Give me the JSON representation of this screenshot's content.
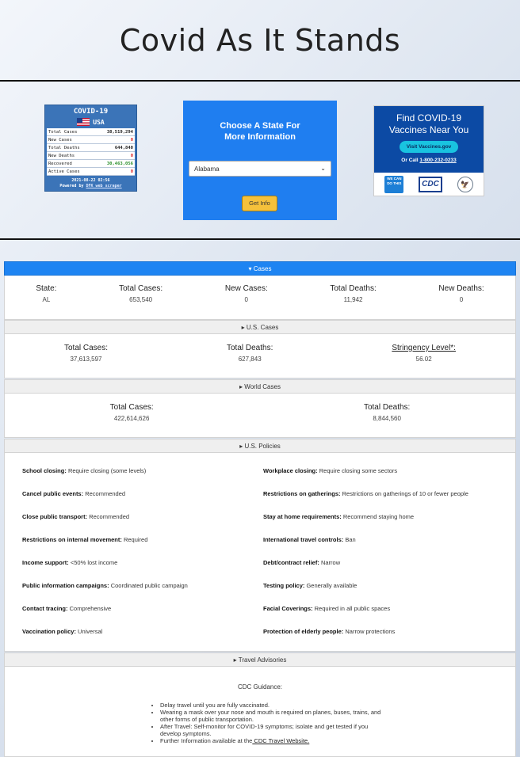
{
  "header": {
    "title": "Covid As It Stands"
  },
  "widget": {
    "title": "COVID-19",
    "country": "USA",
    "rows": [
      {
        "label": "Total Cases",
        "value": "38,519,294"
      },
      {
        "label": "New Cases",
        "value": "0"
      },
      {
        "label": "Total Deaths",
        "value": "644,840"
      },
      {
        "label": "New Deaths",
        "value": "0"
      },
      {
        "label": "Recovered",
        "value": "30,463,056"
      },
      {
        "label": "Active Cases",
        "value": "0"
      }
    ],
    "timestamp": "2021-08-22 02:56",
    "powered_prefix": "Powered by",
    "powered_link": "DFK web scraper"
  },
  "chooser": {
    "title_line1": "Choose A State For",
    "title_line2": "More Information",
    "selected_state": "Alabama",
    "button_label": "Get Info"
  },
  "vaccine": {
    "title_line1": "Find COVID-19",
    "title_line2": "Vaccines Near You",
    "button_label": "Visit Vaccines.gov",
    "call_prefix": "Or Call",
    "phone": "1-800-232-0233",
    "logo_wecan": "WE CAN DO THIS",
    "logo_cdc": "CDC"
  },
  "cases": {
    "header": "Cases",
    "stats": [
      {
        "label": "State:",
        "value": "AL"
      },
      {
        "label": "Total Cases:",
        "value": "653,540"
      },
      {
        "label": "New Cases:",
        "value": "0"
      },
      {
        "label": "Total Deaths:",
        "value": "11,942"
      },
      {
        "label": "New Deaths:",
        "value": "0"
      }
    ]
  },
  "us_cases": {
    "header": "U.S. Cases",
    "stats": [
      {
        "label": "Total Cases:",
        "value": "37,613,597"
      },
      {
        "label": "Total Deaths:",
        "value": "627,843"
      },
      {
        "label": "Stringency Level*:",
        "value": "56.02"
      }
    ]
  },
  "world_cases": {
    "header": "World Cases",
    "stats": [
      {
        "label": "Total Cases:",
        "value": "422,614,626"
      },
      {
        "label": "Total Deaths:",
        "value": "8,844,560"
      }
    ]
  },
  "policies": {
    "header": "U.S. Policies",
    "items": [
      {
        "label": "School closing:",
        "value": "Require closing (some levels)"
      },
      {
        "label": "Workplace closing:",
        "value": "Require closing some sectors"
      },
      {
        "label": "Cancel public events:",
        "value": "Recommended"
      },
      {
        "label": "Restrictions on gatherings:",
        "value": "Restrictions on gatherings of 10 or fewer people"
      },
      {
        "label": "Close public transport:",
        "value": "Recommended"
      },
      {
        "label": "Stay at home requirements:",
        "value": "Recommend staying home"
      },
      {
        "label": "Restrictions on internal movement:",
        "value": "Required"
      },
      {
        "label": "International travel controls:",
        "value": "Ban"
      },
      {
        "label": "Income support:",
        "value": "<50% lost income"
      },
      {
        "label": "Debt/contract relief:",
        "value": "Narrow"
      },
      {
        "label": "Public information campaigns:",
        "value": "Coordinated public campaign"
      },
      {
        "label": "Testing policy:",
        "value": "Generally available"
      },
      {
        "label": "Contact tracing:",
        "value": "Comprehensive"
      },
      {
        "label": "Facial Coverings:",
        "value": "Required in all public spaces"
      },
      {
        "label": "Vaccination policy:",
        "value": "Universal"
      },
      {
        "label": "Protection of elderly people:",
        "value": "Narrow protections"
      }
    ]
  },
  "travel": {
    "header": "Travel Advisories",
    "guidance_title": "CDC Guidance:",
    "items": [
      "Delay travel until you are fully vaccinated.",
      "Wearing a mask over your nose and mouth is required on planes, buses, trains, and other forms of public transportation.",
      "After Travel: Self-monitor for COVID-19 symptoms; isolate and get tested if you develop symptoms."
    ],
    "last_item_prefix": "Further Information available at the",
    "last_item_link": " CDC Travel Website."
  }
}
